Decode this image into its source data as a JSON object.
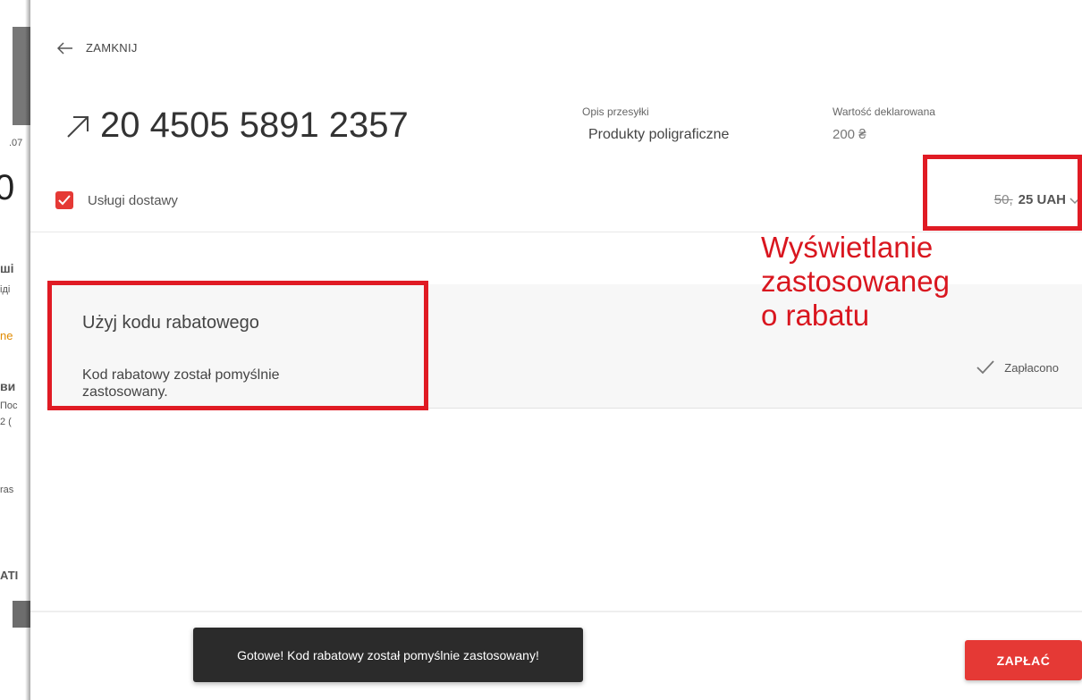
{
  "background": {
    "fragments": [
      "0",
      "ші",
      "іді",
      "ne",
      "ви",
      "Пос",
      "2 (",
      "ras",
      "АТІ",
      ".07"
    ]
  },
  "header": {
    "close_label": "ZAMKNIJ",
    "tracking_number": "20 4505 5891 2357"
  },
  "shipment": {
    "description_label": "Opis przesyłki",
    "description_value": "Produkty poligraficzne",
    "declared_value_label": "Wartość deklarowana",
    "declared_value": "200 ₴"
  },
  "delivery": {
    "services_label": "Usługi dostawy",
    "old_price": "50,",
    "new_price": "25 UAH"
  },
  "discount": {
    "title": "Użyj kodu rabatowego",
    "message": "Kod rabatowy został pomyślnie zastosowany.",
    "paid_label": "Zapłacono"
  },
  "annotation": {
    "text": "Wyświetlanie\nzastosowaneg\no rabatu",
    "color": "#d9161f"
  },
  "toast": {
    "message": "Gotowe! Kod rabatowy został pomyślnie zastosowany!"
  },
  "footer": {
    "pay_label": "ZAPŁAĆ"
  },
  "colors": {
    "accent": "#e53935",
    "highlight": "#e01b24"
  }
}
